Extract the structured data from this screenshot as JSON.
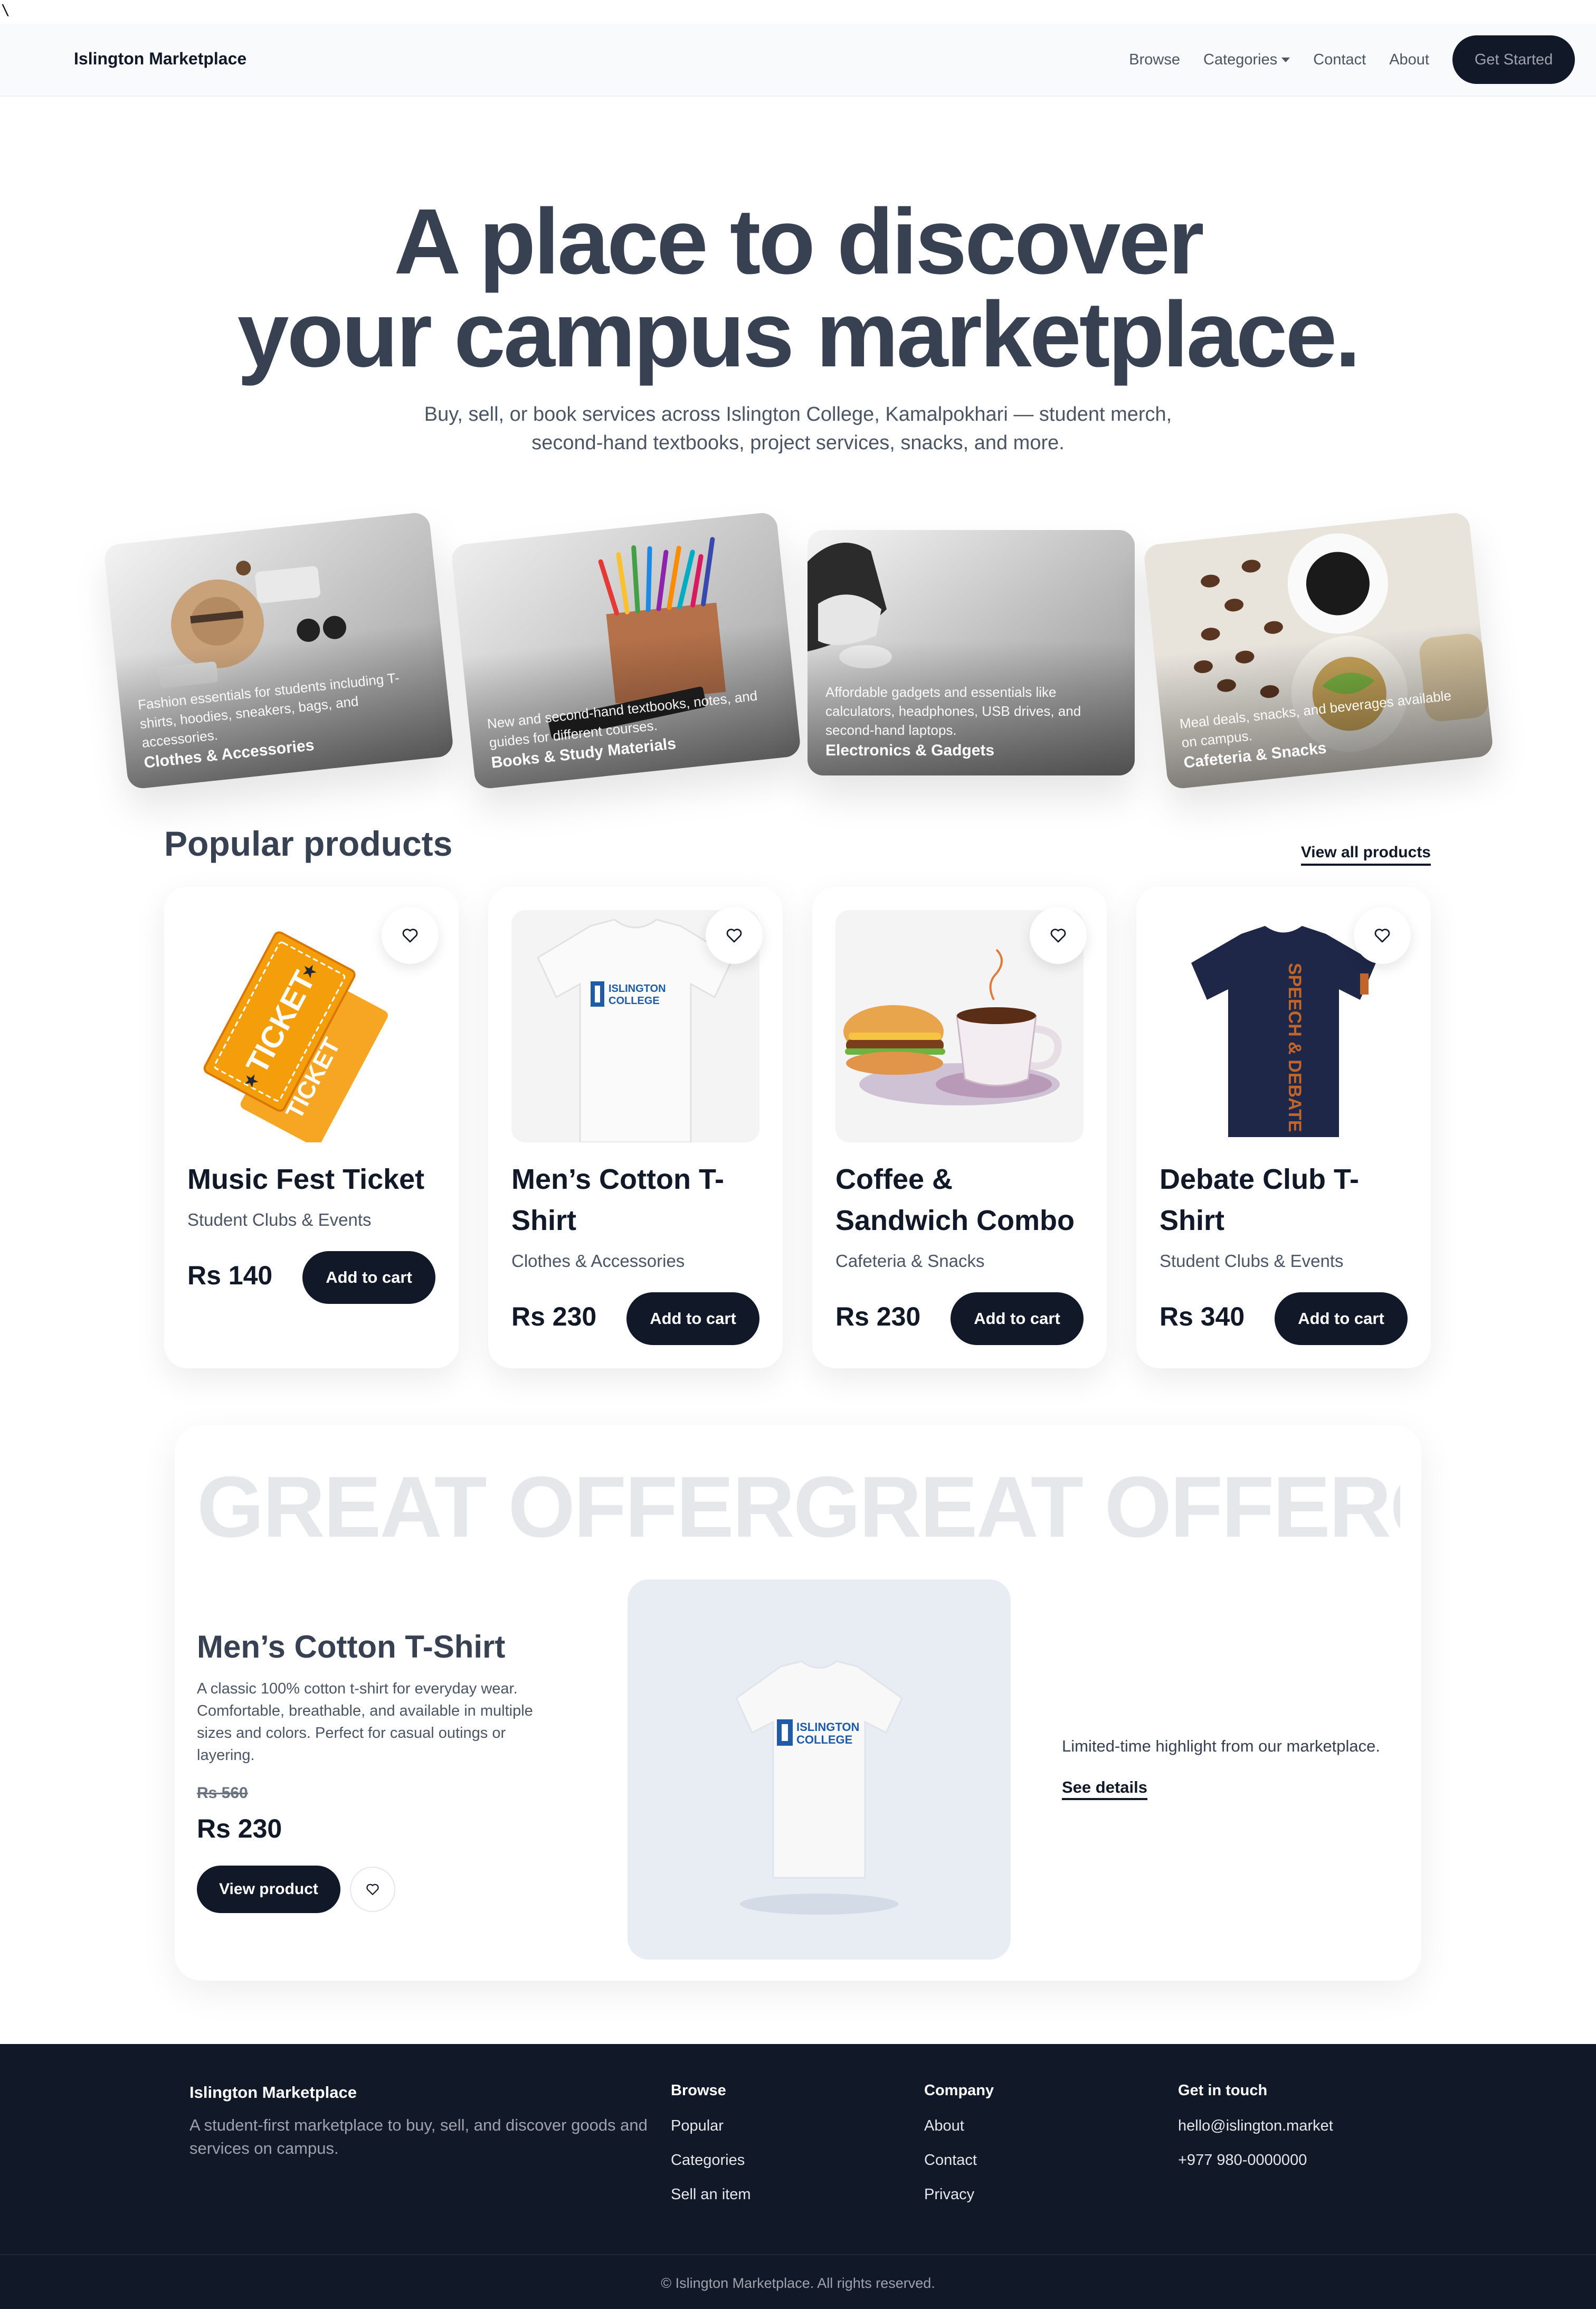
{
  "stray_char": "\\",
  "nav": {
    "brand": "Islington Marketplace",
    "links": [
      "Browse",
      "Categories",
      "Contact",
      "About"
    ],
    "cta": "Get Started"
  },
  "hero": {
    "title_line1": "A place to discover",
    "title_line2": "your campus marketplace.",
    "subtitle_line1": "Buy, sell, or book services across Islington College, Kamalpokhari — student merch,",
    "subtitle_line2": "second-hand textbooks, project services, snacks, and more."
  },
  "categories": [
    {
      "name": "Clothes & Accessories",
      "desc": "Fashion essentials for students including T-shirts, hoodies, sneakers, bags, and accessories."
    },
    {
      "name": "Books & Study Materials",
      "desc": "New and second-hand textbooks, notes, and guides for different courses."
    },
    {
      "name": "Electronics & Gadgets",
      "desc": "Affordable gadgets and essentials like calculators, headphones, USB drives, and second-hand laptops."
    },
    {
      "name": "Cafeteria & Snacks",
      "desc": "Meal deals, snacks, and beverages available on campus."
    }
  ],
  "popular": {
    "title": "Popular products",
    "view_all": "View all products",
    "add_label": "Add to cart",
    "products": [
      {
        "name": "Music Fest Ticket",
        "category": "Student Clubs & Events",
        "price": "Rs 140"
      },
      {
        "name": "Men’s Cotton T-Shirt",
        "category": "Clothes & Accessories",
        "price": "Rs 230"
      },
      {
        "name": "Coffee & Sandwich Combo",
        "category": "Cafeteria & Snacks",
        "price": "Rs 230"
      },
      {
        "name": "Debate Club T-Shirt",
        "category": "Student Clubs & Events",
        "price": "Rs 340"
      }
    ],
    "ticket_word": "TICKET",
    "shirt_logo_line1": "ISLINGTON",
    "shirt_logo_line2": "COLLEGE",
    "debate_print": "SPEECH & DEBATE"
  },
  "offer": {
    "marquee": "GREAT OFFERGREAT OFFERGREAT OFFER",
    "name": "Men’s Cotton T-Shirt",
    "description": "A classic 100% cotton t-shirt for everyday wear. Comfortable, breathable, and available in multiple sizes and colors. Perfect for casual outings or layering.",
    "old_price": "Rs 560",
    "new_price": "Rs 230",
    "view_button": "View product",
    "note": "Limited-time highlight from our marketplace.",
    "see_details": "See details"
  },
  "footer": {
    "brand": "Islington Marketplace",
    "tagline": "A student-first marketplace to buy, sell, and discover goods and services on campus.",
    "columns": [
      {
        "heading": "Browse",
        "items": [
          "Popular",
          "Categories",
          "Sell an item"
        ]
      },
      {
        "heading": "Company",
        "items": [
          "About",
          "Contact",
          "Privacy"
        ]
      },
      {
        "heading": "Get in touch",
        "items": [
          "hello@islington.market",
          "+977 980-0000000"
        ]
      }
    ],
    "copyright": "© Islington Marketplace. All rights reserved."
  },
  "colors": {
    "primary": "#111827",
    "heading": "#374151",
    "muted": "#4b5563",
    "ticket": "#f59e0b",
    "navy_shirt": "#1e2747",
    "debate_print": "#c2652a"
  }
}
